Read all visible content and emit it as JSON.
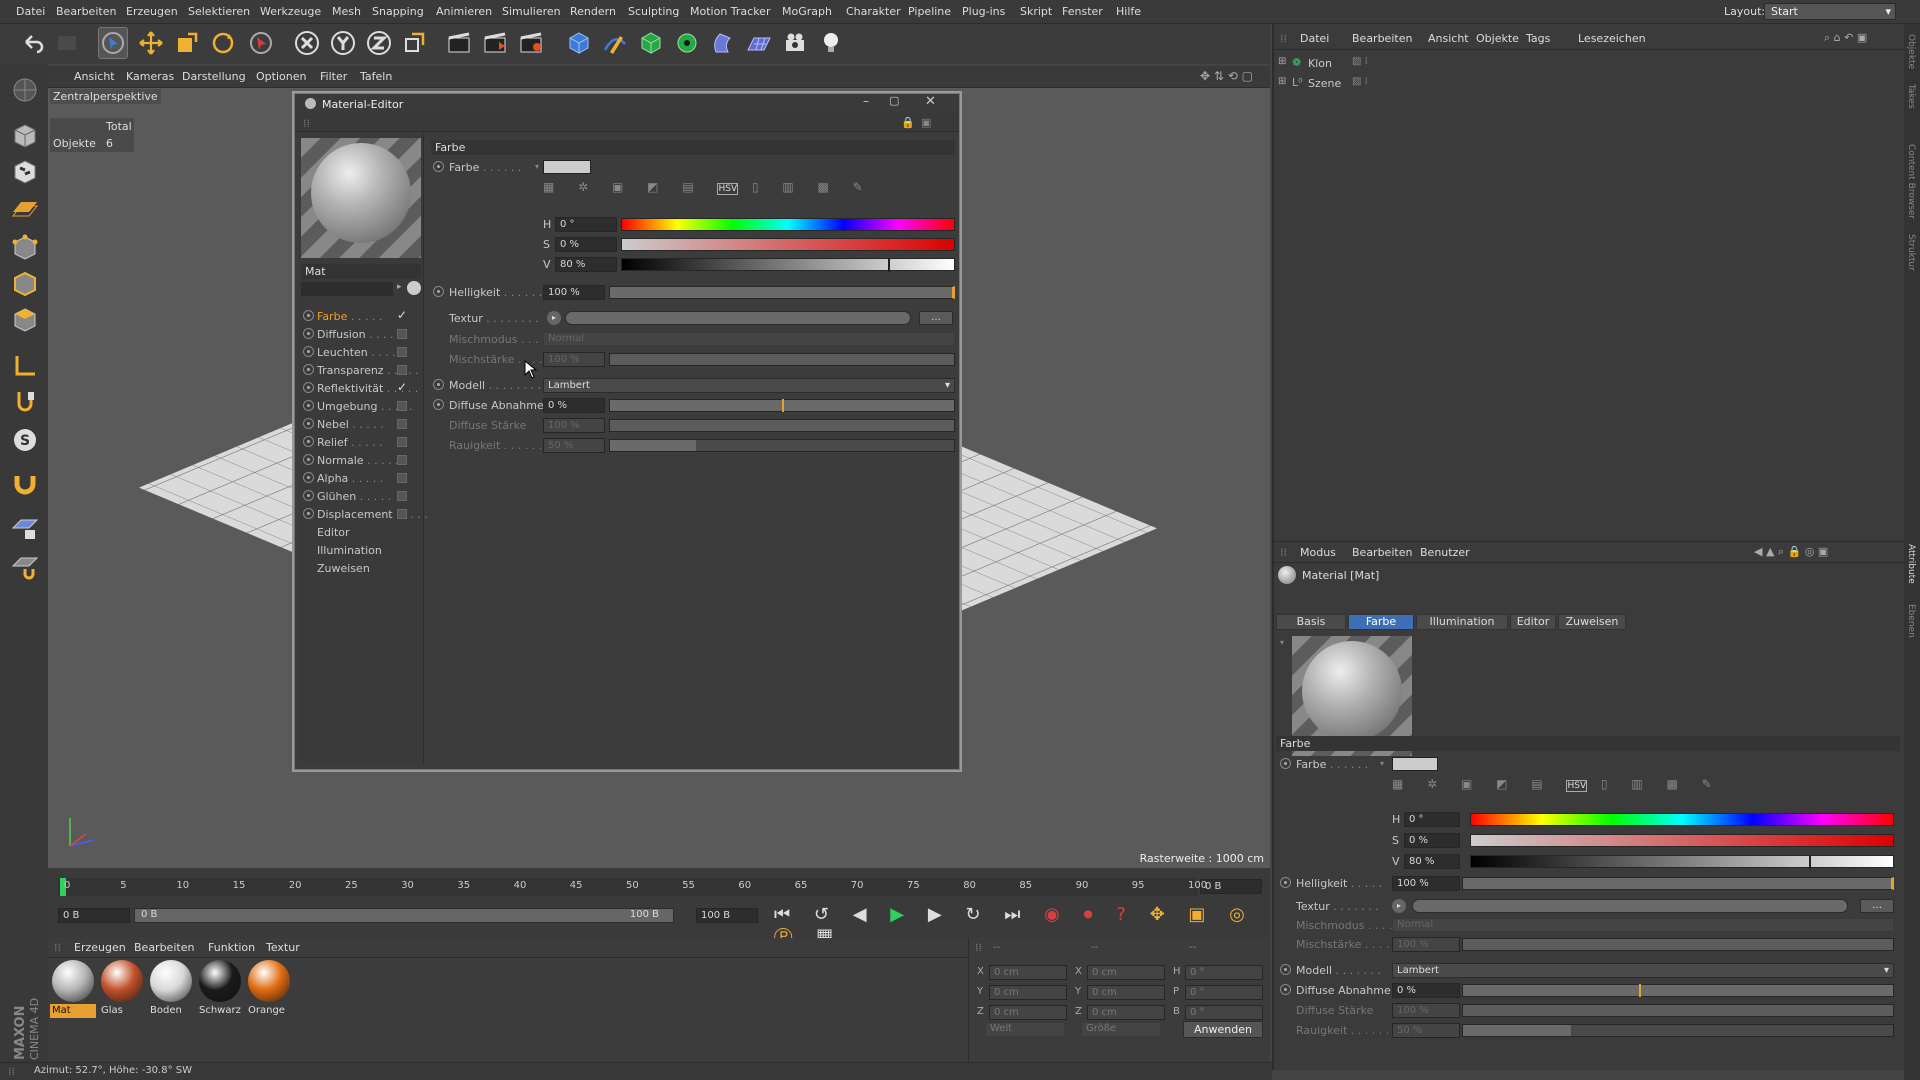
{
  "menubar": {
    "items": [
      "Datei",
      "Bearbeiten",
      "Erzeugen",
      "Selektieren",
      "Werkzeuge",
      "Mesh",
      "Snapping",
      "Animieren",
      "Simulieren",
      "Rendern",
      "Sculpting",
      "Motion Tracker",
      "MoGraph",
      "Charakter",
      "Pipeline",
      "Plug-ins",
      "Skript",
      "Fenster",
      "Hilfe"
    ],
    "layout_label": "Layout:",
    "layout_value": "Start"
  },
  "viewport_menu": [
    "Ansicht",
    "Kameras",
    "Darstellung",
    "Optionen",
    "Filter",
    "Tafeln"
  ],
  "viewport": {
    "camera_label": "Zentralperspektive",
    "stats_header": "Total",
    "stats_label": "Objekte",
    "stats_value": "6",
    "grid_info": "Rasterweite : 1000 cm"
  },
  "material_editor": {
    "title": "Material-Editor",
    "material_name": "Mat",
    "channels": [
      {
        "label": "Farbe",
        "active": true,
        "checked": true
      },
      {
        "label": "Diffusion",
        "active": false,
        "checked": false
      },
      {
        "label": "Leuchten",
        "active": false,
        "checked": false
      },
      {
        "label": "Transparenz",
        "active": false,
        "checked": false
      },
      {
        "label": "Reflektivität",
        "active": false,
        "checked": true
      },
      {
        "label": "Umgebung",
        "active": false,
        "checked": false
      },
      {
        "label": "Nebel",
        "active": false,
        "checked": false
      },
      {
        "label": "Relief",
        "active": false,
        "checked": false
      },
      {
        "label": "Normale",
        "active": false,
        "checked": false
      },
      {
        "label": "Alpha",
        "active": false,
        "checked": false
      },
      {
        "label": "Glühen",
        "active": false,
        "checked": false
      },
      {
        "label": "Displacement",
        "active": false,
        "checked": false
      }
    ],
    "extra_items": [
      "Editor",
      "Illumination",
      "Zuweisen"
    ],
    "section": "Farbe",
    "farbe_label": "Farbe",
    "h_label": "H",
    "h_value": "0 °",
    "s_label": "S",
    "s_value": "0 %",
    "v_label": "V",
    "v_value": "80 %",
    "helligkeit_label": "Helligkeit",
    "helligkeit_value": "100 %",
    "textur_label": "Textur",
    "mischmodus_label": "Mischmodus",
    "mischmodus_value": "Normal",
    "mischstaerke_label": "Mischstärke",
    "mischstaerke_value": "100 %",
    "modell_label": "Modell",
    "modell_value": "Lambert",
    "diffuse_abnahme_label": "Diffuse Abnahme",
    "diffuse_abnahme_value": "0 %",
    "diffuse_staerke_label": "Diffuse Stärke",
    "diffuse_staerke_value": "100 %",
    "rauigkeit_label": "Rauigkeit",
    "rauigkeit_value": "50 %",
    "v_fraction": 0.8,
    "diffuse_abnahme_fraction": 0.5,
    "rauigkeit_fraction": 0.25
  },
  "object_manager": {
    "menu": [
      "Datei",
      "Bearbeiten",
      "Ansicht",
      "Objekte",
      "Tags",
      "Lesezeichen"
    ],
    "objects": [
      "Klon",
      "Szene"
    ]
  },
  "attribute_manager": {
    "menu": [
      "Modus",
      "Bearbeiten",
      "Benutzer"
    ],
    "title": "Material [Mat]",
    "tabs": [
      "Basis",
      "Farbe",
      "Illumination",
      "Editor",
      "Zuweisen"
    ],
    "active_tab": "Farbe"
  },
  "side_tabs": [
    "Objekte",
    "Takes",
    "Content Browser",
    "Struktur",
    "Attribute",
    "Ebenen"
  ],
  "timeline": {
    "ticks": [
      "0",
      "5",
      "10",
      "15",
      "20",
      "25",
      "30",
      "35",
      "40",
      "45",
      "50",
      "55",
      "60",
      "65",
      "70",
      "75",
      "80",
      "85",
      "90",
      "95",
      "100"
    ],
    "current_frame": "0 B",
    "start_frame": "0 B",
    "range_start": "0 B",
    "range_end": "100 B",
    "end_frame": "100 B"
  },
  "material_manager": {
    "menu": [
      "Erzeugen",
      "Bearbeiten",
      "Funktion",
      "Textur"
    ],
    "materials": [
      {
        "name": "Mat",
        "color": "#b5b5b5"
      },
      {
        "name": "Glas",
        "color": "#c0502a"
      },
      {
        "name": "Boden",
        "color": "#d8d8d8"
      },
      {
        "name": "Schwarz",
        "color": "#1a1a1a"
      },
      {
        "name": "Orange",
        "color": "#e06a10"
      }
    ]
  },
  "coordinates": {
    "header": [
      "--",
      "--",
      "--"
    ],
    "rows": [
      {
        "a": "X",
        "av": "0 cm",
        "b": "X",
        "bv": "0 cm",
        "c": "H",
        "cv": "0 °"
      },
      {
        "a": "Y",
        "av": "0 cm",
        "b": "Y",
        "bv": "0 cm",
        "c": "P",
        "cv": "0 °"
      },
      {
        "a": "Z",
        "av": "0 cm",
        "b": "Z",
        "bv": "0 cm",
        "c": "B",
        "cv": "0 °"
      }
    ],
    "mode1": "Welt",
    "mode2": "Größe",
    "apply": "Anwenden"
  },
  "status": "Azimut: 52.7°, Höhe: -30.8°  SW",
  "logo": "MAXON CINEMA 4D",
  "colors": {
    "accent_orange": "#e8a030",
    "tab_active": "#3d6fb5"
  }
}
